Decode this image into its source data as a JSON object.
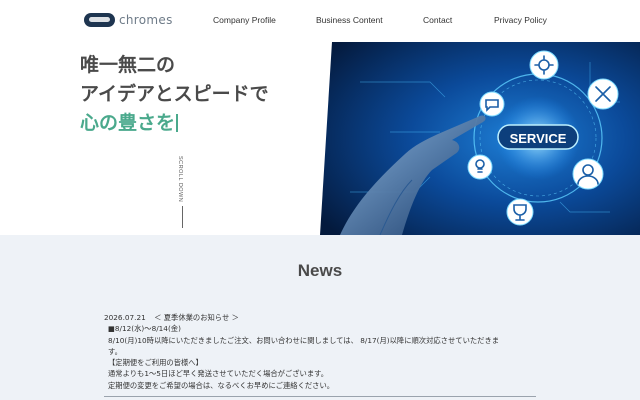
{
  "header": {
    "logo_text": "chromes",
    "nav": [
      {
        "label": "Company Profile"
      },
      {
        "label": "Business Content"
      },
      {
        "label": "Contact"
      },
      {
        "label": "Privacy Policy"
      }
    ]
  },
  "hero": {
    "line1": "唯一無二の",
    "line2": "アイデアとスピードで",
    "line3": "心の豊さを",
    "scroll_label": "SCROLL DOWN",
    "image_label": "SERVICE",
    "accent_color": "#4aa98c"
  },
  "news": {
    "title": "News",
    "items": [
      {
        "date": "2026.07.21",
        "headline": "＜ 夏季休業のお知らせ ＞",
        "body": [
          "■8/12(水)〜8/14(金)",
          "8/10(月)10時以降にいただきましたご注文、お問い合わせに関しましては、 8/17(月)以降に順次対応させていただきま",
          "す。",
          "【定期便をご利用の皆様へ】",
          "通常よりも1〜5日ほど早く発送させていただく場合がございます。",
          "定期便の変更をご希望の場合は、なるべくお早めにご連絡ください。"
        ]
      }
    ]
  },
  "colors": {
    "logo_mark": "#1e3550",
    "news_bg": "#eef2f7",
    "hero_accent": "#4aa98c",
    "hero_image_bg": "#0a2a5a"
  }
}
